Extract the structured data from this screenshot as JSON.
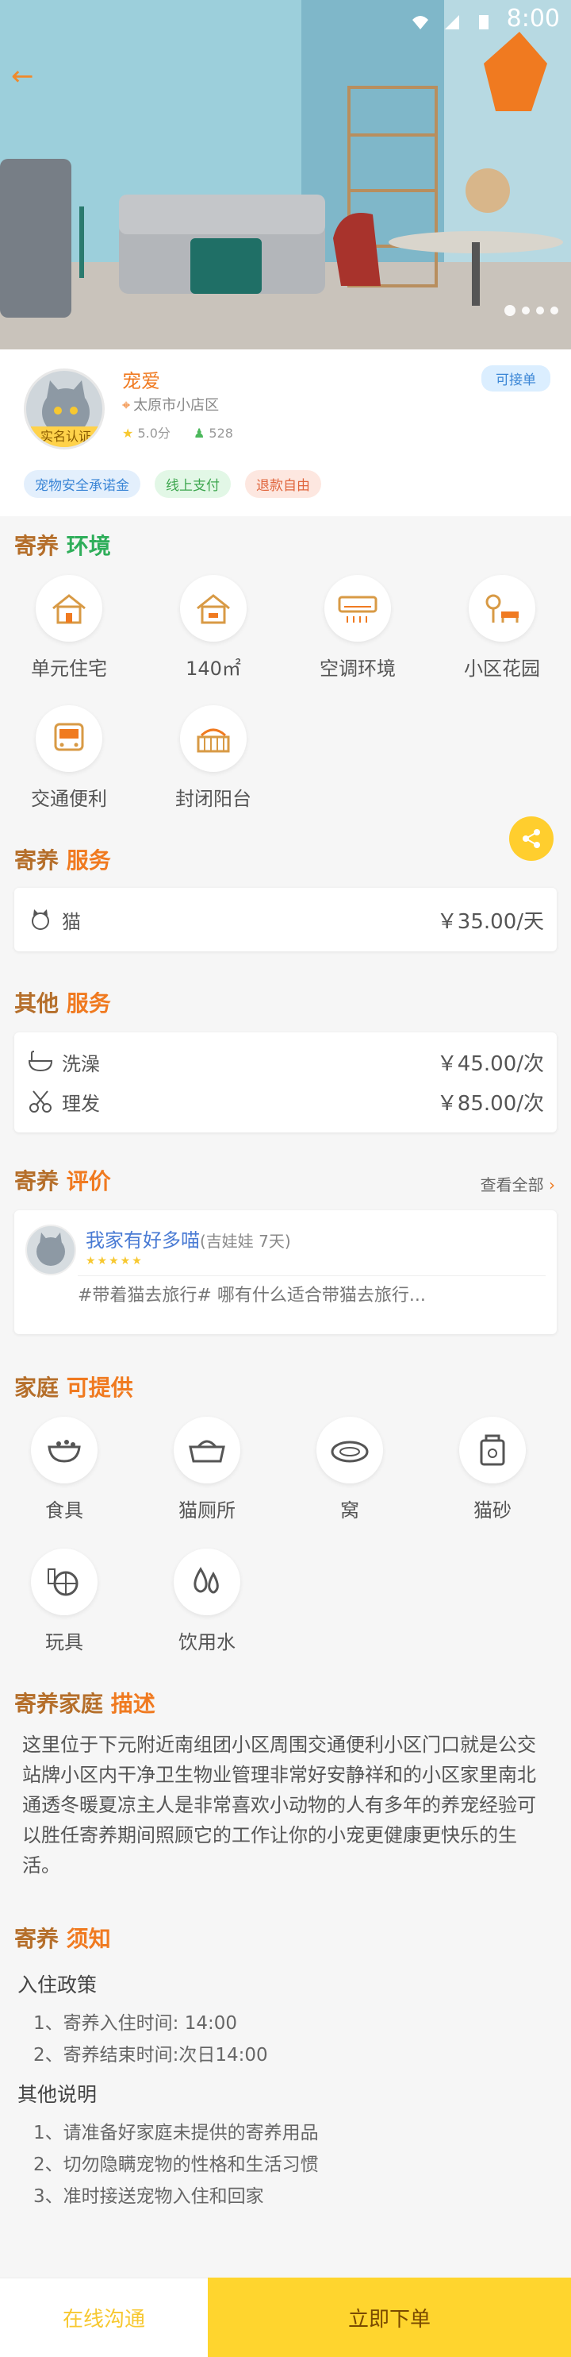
{
  "status": {
    "time": "8:00"
  },
  "profile": {
    "name": "宠爱",
    "location": "太原市小店区",
    "rating": "5.0分",
    "count": "528",
    "badge": "实名认证",
    "availability": "可接单",
    "tags": [
      "宠物安全承诺金",
      "线上支付",
      "退款自由"
    ]
  },
  "environment": {
    "title_a": "寄养",
    "title_b": "环境",
    "items": [
      {
        "label": "单元住宅",
        "icon": "house-icon"
      },
      {
        "label": "140㎡",
        "icon": "house-area-icon"
      },
      {
        "label": "空调环境",
        "icon": "air-conditioner-icon"
      },
      {
        "label": "小区花园",
        "icon": "garden-icon"
      },
      {
        "label": "交通便利",
        "icon": "bus-icon"
      },
      {
        "label": "封闭阳台",
        "icon": "balcony-icon"
      }
    ]
  },
  "service": {
    "title_a": "寄养",
    "title_b": "服务",
    "items": [
      {
        "name": "猫",
        "price": "￥35.00/天",
        "icon": "cat-icon"
      }
    ]
  },
  "other_service": {
    "title_a": "其他",
    "title_b": "服务",
    "items": [
      {
        "name": "洗澡",
        "price": "￥45.00/次",
        "icon": "bathtub-icon"
      },
      {
        "name": "理发",
        "price": "￥85.00/次",
        "icon": "scissors-icon"
      }
    ]
  },
  "reviews": {
    "title_a": "寄养",
    "title_b": "评价",
    "view_all": "查看全部",
    "item": {
      "name": "我家有好多喵",
      "sub": "(吉娃娃  7天)",
      "stars": "★★★★★",
      "text": "#带着猫去旅行# 哪有什么适合带猫去旅行..."
    }
  },
  "provide": {
    "title_a": "家庭",
    "title_b": "可提供",
    "items": [
      {
        "label": "食具",
        "icon": "bowl-icon"
      },
      {
        "label": "猫厕所",
        "icon": "litter-box-icon"
      },
      {
        "label": "窝",
        "icon": "pet-bed-icon"
      },
      {
        "label": "猫砂",
        "icon": "litter-bag-icon"
      },
      {
        "label": "玩具",
        "icon": "toy-icon"
      },
      {
        "label": "饮用水",
        "icon": "water-drop-icon"
      }
    ]
  },
  "description": {
    "title_a": "寄养家庭",
    "title_b": "描述",
    "text": "这里位于下元附近南组团小区周围交通便利小区门口就是公交站牌小区内干净卫生物业管理非常好安静祥和的小区家里南北通透冬暖夏凉主人是非常喜欢小动物的人有多年的养宠经验可以胜任寄养期间照顾它的工作让你的小宠更健康更快乐的生活。"
  },
  "notice": {
    "title_a": "寄养",
    "title_b": "须知",
    "policy_title": "入住政策",
    "policy": [
      "1、寄养入住时间: 14:00",
      "2、寄养结束时间:次日14:00"
    ],
    "other_title": "其他说明",
    "other": [
      "1、请准备好家庭未提供的寄养用品",
      "2、切勿隐瞒宠物的性格和生活习惯",
      "3、准时接送宠物入住和回家"
    ]
  },
  "bottom": {
    "chat": "在线沟通",
    "order": "立即下单"
  },
  "colors": {
    "accent": "#f07a20",
    "primary": "#ffd52e",
    "green": "#2fae5a"
  }
}
